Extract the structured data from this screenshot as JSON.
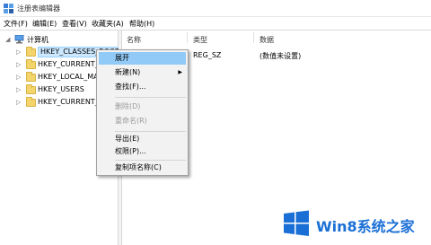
{
  "window": {
    "title": "注册表编辑器",
    "accent": "#1a6fd6"
  },
  "menu": [
    "文件(F)",
    "编辑(E)",
    "查看(V)",
    "收藏夹(A)",
    "帮助(H)"
  ],
  "tree": {
    "root": "计算机",
    "keys": [
      "HKEY_CLASSES_ROOT",
      "HKEY_CURRENT_U",
      "HKEY_LOCAL_MAC",
      "HKEY_USERS",
      "HKEY_CURRENT_C"
    ],
    "selected_index": 0
  },
  "list": {
    "columns": [
      "名称",
      "类型",
      "数据"
    ],
    "rows": [
      {
        "name": "",
        "type": "REG_SZ",
        "data": "(数值未设置)"
      }
    ]
  },
  "context_menu": {
    "items": [
      {
        "label": "展开",
        "state": "hover"
      },
      {
        "label": "新建(N)",
        "submenu": true
      },
      {
        "label": "查找(F)..."
      },
      {
        "label": "删除(D)",
        "state": "disabled"
      },
      {
        "label": "重命名(R)",
        "state": "disabled"
      },
      {
        "label": "导出(E)"
      },
      {
        "label": "权限(P)..."
      },
      {
        "label": "复制项名称(C)"
      }
    ]
  },
  "watermark": {
    "text": "Win8系统之家"
  }
}
